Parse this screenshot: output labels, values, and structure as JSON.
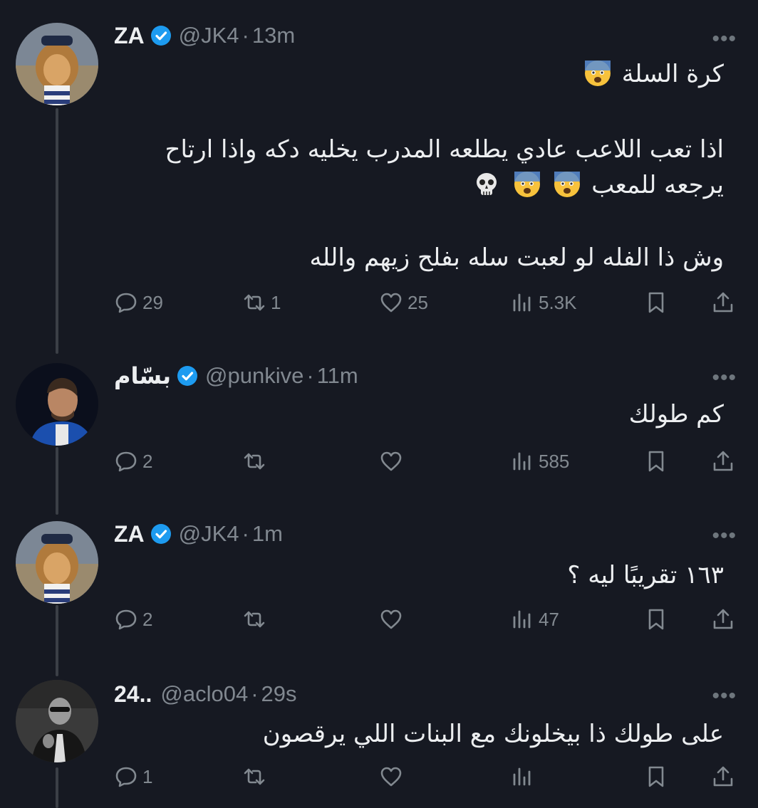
{
  "tweets": [
    {
      "name": "ZA",
      "handle": "@JK4",
      "separator": "·",
      "time": "13m",
      "more": "•••",
      "lines": [
        "كرة السلة",
        "اذا تعب اللاعب عادي يطلعه المدرب يخليه دكه واذا ارتاح",
        "يرجعه للمعب",
        "وش ذا الفله لو لعبت سله بفلح زيهم والله"
      ],
      "emojis": [
        "anxious-face",
        "anxious-face",
        "anxious-face",
        "skull"
      ],
      "replies": "29",
      "reposts": "1",
      "likes": "25",
      "views": "5.3K"
    },
    {
      "name": "بسّام",
      "handle": "@punkive",
      "separator": "·",
      "time": "11m",
      "more": "•••",
      "lines": [
        "كم طولك"
      ],
      "replies": "2",
      "reposts": "",
      "likes": "",
      "views": "585"
    },
    {
      "name": "ZA",
      "handle": "@JK4",
      "separator": "·",
      "time": "1m",
      "more": "•••",
      "lines": [
        "١٦٣ تقريبًا ليه ؟"
      ],
      "replies": "2",
      "reposts": "",
      "likes": "",
      "views": "47"
    },
    {
      "name": "24..",
      "handle": "@aclo04",
      "separator": "·",
      "time": "29s",
      "more": "•••",
      "lines": [
        "على طولك ذا بيخلونك مع البنات اللي يرقصون"
      ],
      "replies": "1",
      "reposts": "",
      "likes": "",
      "views": ""
    }
  ],
  "colors": {
    "background": "#161922",
    "text": "#eceef0",
    "muted": "#818890",
    "verified": "#1d9bf0",
    "thread_line": "#3b3f46"
  }
}
